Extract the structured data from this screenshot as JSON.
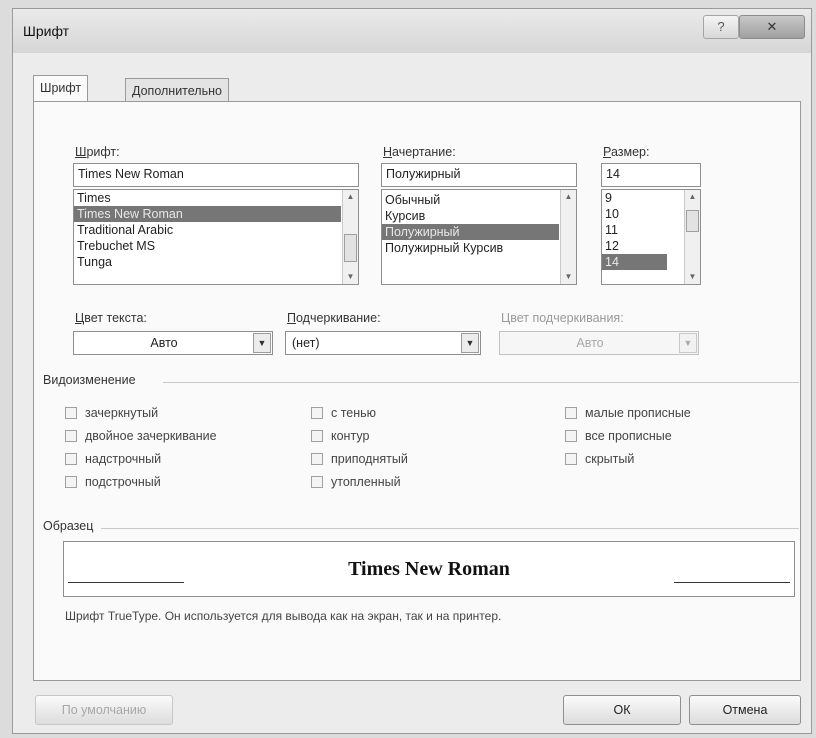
{
  "window": {
    "title": "Шрифт",
    "help_label": "?",
    "close_label": "✕"
  },
  "tabs": [
    {
      "label": "Шрифт",
      "active": true
    },
    {
      "label": "Дополнительно",
      "active": false
    }
  ],
  "font": {
    "label": "Шрифт:",
    "value": "Times New Roman",
    "items": [
      "Times",
      "Times New Roman",
      "Traditional Arabic",
      "Trebuchet MS",
      "Tunga"
    ],
    "selected_index": 1
  },
  "style": {
    "label": "Начертание:",
    "value": "Полужирный",
    "items": [
      "Обычный",
      "Курсив",
      "Полужирный",
      "Полужирный Курсив"
    ],
    "selected_index": 2
  },
  "size": {
    "label": "Размер:",
    "value": "14",
    "items": [
      "9",
      "10",
      "11",
      "12",
      "14"
    ],
    "selected_index": 4
  },
  "text_color": {
    "label": "Цвет текста:",
    "value": "Авто"
  },
  "underline": {
    "label": "Подчеркивание:",
    "value": "(нет)"
  },
  "underline_color": {
    "label": "Цвет подчеркивания:",
    "value": "Авто",
    "disabled": true
  },
  "effects": {
    "label": "Видоизменение",
    "col1": [
      {
        "label": "зачеркнутый",
        "checked": false
      },
      {
        "label": "двойное зачеркивание",
        "checked": false
      },
      {
        "label": "надстрочный",
        "checked": false
      },
      {
        "label": "подстрочный",
        "checked": false
      }
    ],
    "col2": [
      {
        "label": "с тенью",
        "checked": false
      },
      {
        "label": "контур",
        "checked": false
      },
      {
        "label": "приподнятый",
        "checked": false
      },
      {
        "label": "утопленный",
        "checked": false
      }
    ],
    "col3": [
      {
        "label": "малые прописные",
        "checked": false
      },
      {
        "label": "все прописные",
        "checked": false
      },
      {
        "label": "скрытый",
        "checked": false
      }
    ]
  },
  "preview": {
    "label": "Образец",
    "text": "Times New Roman",
    "description": "Шрифт TrueType. Он используется для вывода как на экран, так и на принтер."
  },
  "buttons": {
    "default": "По умолчанию",
    "ok": "ОК",
    "cancel": "Отмена"
  },
  "colors": {
    "selection": "#767676",
    "dialog_bg": "#ececec"
  }
}
